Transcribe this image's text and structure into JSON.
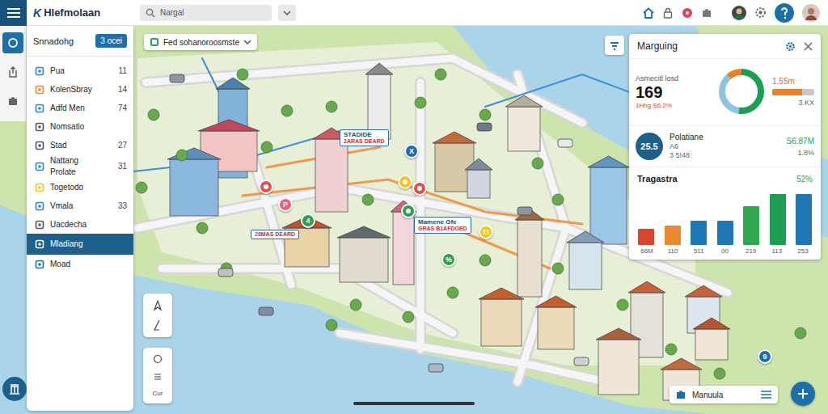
{
  "app": {
    "logo": "K",
    "title": "Hlefmolaan"
  },
  "search": {
    "value": "Nargal"
  },
  "sidebar": {
    "title": "Snnadohg",
    "button": "3 ocei",
    "items": [
      {
        "label": "Pua",
        "count": "11",
        "selected": false
      },
      {
        "label": "KolenSbray",
        "count": "14",
        "selected": false
      },
      {
        "label": "Adfd Men",
        "count": "74",
        "selected": false
      },
      {
        "label": "Nomsatio",
        "selected": false
      },
      {
        "label": "Stad",
        "count": "27",
        "selected": false
      },
      {
        "label": "Nattang",
        "sub": "Prolate",
        "count": "31",
        "selected": false
      },
      {
        "label": "Togetodo",
        "selected": false
      },
      {
        "label": "Vmala",
        "count": "33",
        "selected": false
      },
      {
        "label": "Uacdecha",
        "selected": false
      },
      {
        "label": "Mladiang",
        "selected": true
      },
      {
        "label": "Moad",
        "selected": false
      }
    ]
  },
  "map": {
    "layer": "Fed sohanoroosmste",
    "labels": [
      {
        "title": "STADIDE",
        "sub": "2ARAS DEARD"
      },
      {
        "title": "Mamene Gfe",
        "sub": "GRAS B1AFDOED"
      },
      {
        "sub": "28MAS DEARD"
      }
    ],
    "markers": [
      {
        "color": "#d9534f"
      },
      {
        "text": "P",
        "color": "#e8607a"
      },
      {
        "text": "X",
        "color": "#1c6fa8"
      },
      {
        "color": "#f5c518"
      },
      {
        "color": "#d9534f"
      },
      {
        "text": "4",
        "color": "#2e9e4f"
      },
      {
        "color": "#2e9e4f"
      },
      {
        "text": "11",
        "color": "#f5c518"
      },
      {
        "text": "%",
        "color": "#2e9e4f"
      },
      {
        "text": "9",
        "color": "#1c6fa8"
      }
    ],
    "tools": {
      "label": "Cur"
    },
    "location": "Manuula"
  },
  "panel": {
    "title": "Marguing",
    "stat": {
      "label": "Asmecitl losd",
      "value": "169",
      "change": "1Hhg S6.2%"
    },
    "donut": [
      {
        "level": 0.52,
        "color": "#1e9e52"
      },
      {
        "level": 0.36,
        "color": "#8cc4e6"
      },
      {
        "level": 0.12,
        "color": "#e8822a"
      }
    ],
    "meter": {
      "value": "1.55m",
      "level": 0.72,
      "sub": "3.KX"
    },
    "population": {
      "badge": "25.5",
      "title": "Polatiane",
      "tag": "A6",
      "detail": "3 5!48",
      "value": "S6.87M",
      "change": "1.8%"
    },
    "chart": {
      "title": "Tragastra",
      "percent": "52%",
      "values": [
        22,
        26,
        32,
        32,
        52,
        68,
        68
      ],
      "labels": [
        "66M",
        "110",
        "511",
        "00",
        "219",
        "113",
        "253"
      ],
      "colors": [
        "#d9452f",
        "#e8892f",
        "#1f78b4",
        "#1f78b4",
        "#2ea84f",
        "#1e9e52",
        "#1f78b4"
      ]
    }
  }
}
